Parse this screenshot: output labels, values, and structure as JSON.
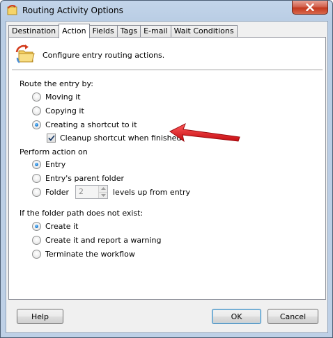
{
  "window": {
    "title": "Routing Activity Options",
    "close_icon": "close-icon"
  },
  "tabs": [
    {
      "label": "Destination",
      "active": false
    },
    {
      "label": "Action",
      "active": true
    },
    {
      "label": "Fields",
      "active": false
    },
    {
      "label": "Tags",
      "active": false
    },
    {
      "label": "E-mail",
      "active": false
    },
    {
      "label": "Wait Conditions",
      "active": false
    }
  ],
  "header": {
    "icon": "routing-folder-icon",
    "text": "Configure entry routing actions."
  },
  "route": {
    "label": "Route the entry by:",
    "options": [
      "Moving it",
      "Copying it",
      "Creating a shortcut to it"
    ],
    "selected": "Creating a shortcut to it",
    "cleanup_label": "Cleanup shortcut when finished",
    "cleanup_checked": true
  },
  "perform": {
    "label": "Perform action on",
    "options": [
      "Entry",
      "Entry's parent folder",
      "Folder"
    ],
    "selected": "Entry",
    "folder_levels_value": "2",
    "levels_label": "levels up from entry"
  },
  "missing": {
    "label": "If the folder path does not exist:",
    "options": [
      "Create it",
      "Create it and report a warning",
      "Terminate the workflow"
    ],
    "selected": "Create it"
  },
  "annotation": {
    "arrow_color": "#e8161b"
  },
  "buttons": {
    "help": "Help",
    "ok": "OK",
    "cancel": "Cancel"
  }
}
